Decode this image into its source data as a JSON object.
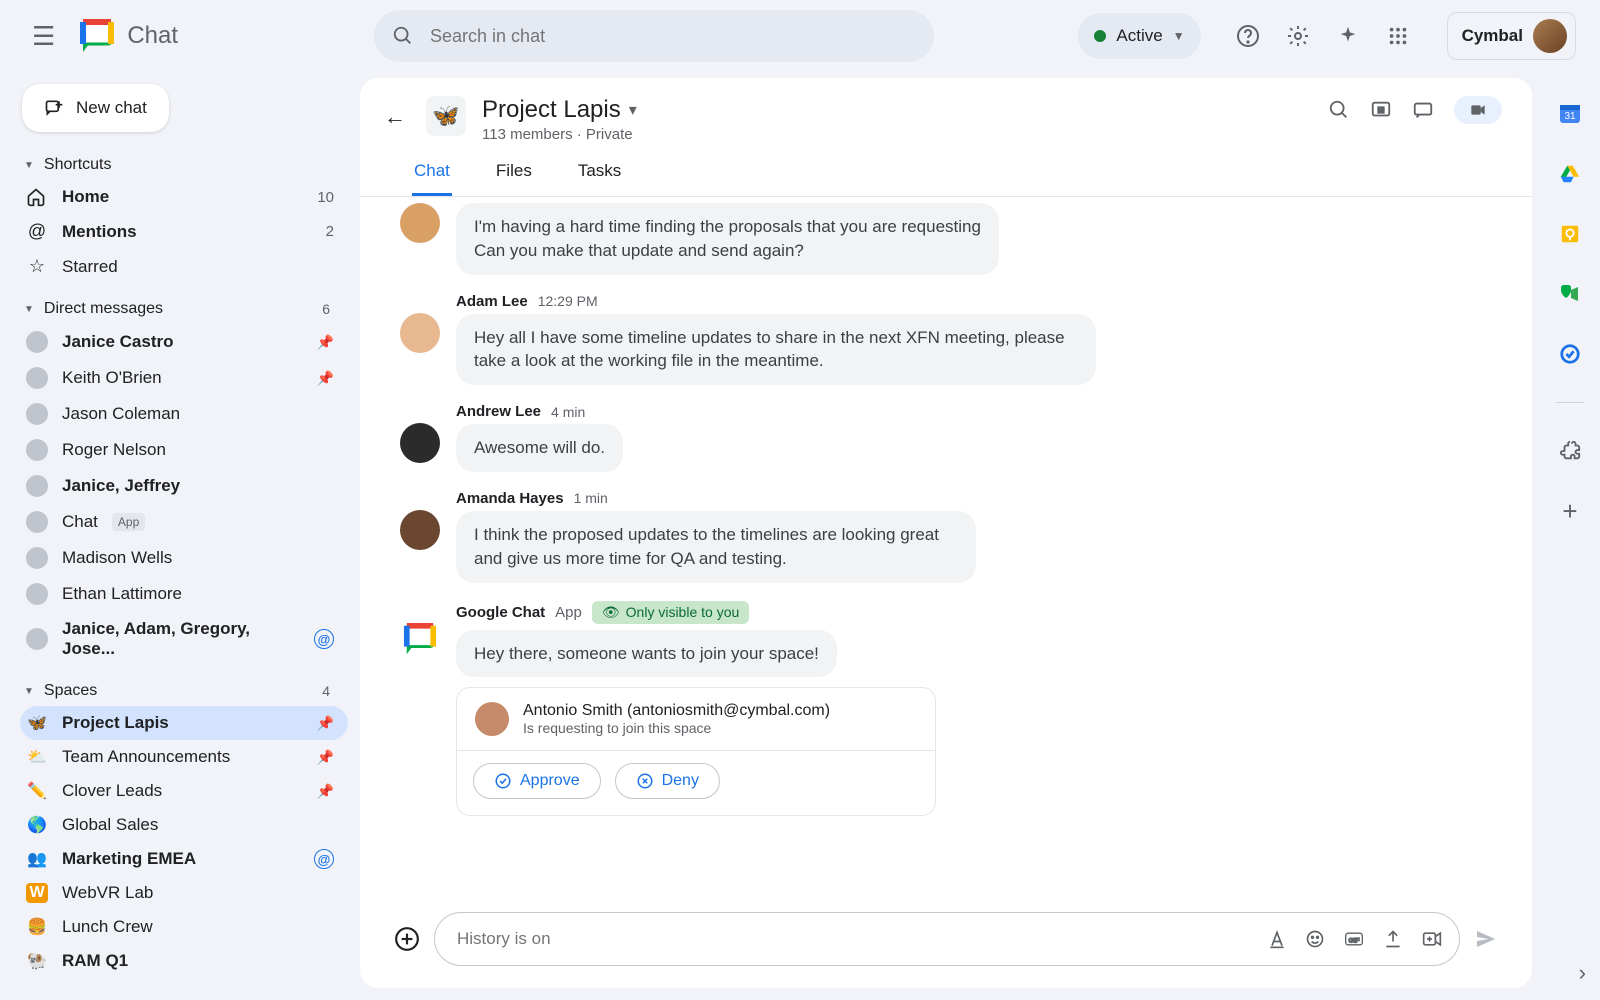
{
  "app_title": "Chat",
  "search_placeholder": "Search in chat",
  "status_label": "Active",
  "org_label": "Cymbal",
  "sidebar": {
    "new_chat": "New chat",
    "shortcuts_label": "Shortcuts",
    "home": "Home",
    "home_count": "10",
    "mentions": "Mentions",
    "mentions_count": "2",
    "starred": "Starred",
    "dms_label": "Direct messages",
    "dms_count": "6",
    "dms": [
      {
        "name": "Janice Castro",
        "bold": true,
        "pin": true
      },
      {
        "name": "Keith O'Brien",
        "bold": false,
        "pin": true
      },
      {
        "name": "Jason Coleman",
        "bold": false
      },
      {
        "name": "Roger Nelson",
        "bold": false
      },
      {
        "name": "Janice, Jeffrey",
        "bold": true
      },
      {
        "name": "Chat",
        "bold": false,
        "app": true
      },
      {
        "name": "Madison Wells",
        "bold": false
      },
      {
        "name": "Ethan Lattimore",
        "bold": false
      },
      {
        "name": "Janice, Adam, Gregory, Jose...",
        "bold": true,
        "mention": true
      }
    ],
    "app_badge": "App",
    "spaces_label": "Spaces",
    "spaces_count": "4",
    "spaces": [
      {
        "emoji": "🦋",
        "name": "Project Lapis",
        "bold": true,
        "pin": true,
        "selected": true
      },
      {
        "emoji": "⛅",
        "name": "Team Announcements",
        "pin": true
      },
      {
        "emoji": "✏️",
        "name": "Clover Leads",
        "pin": true
      },
      {
        "emoji": "🌎",
        "name": "Global Sales"
      },
      {
        "emoji": "👥",
        "name": "Marketing EMEA",
        "bold": true,
        "mention": true
      },
      {
        "emoji": "🟧",
        "name": "WebVR Lab",
        "wchar": "W"
      },
      {
        "emoji": "🍔",
        "name": "Lunch Crew"
      },
      {
        "emoji": "🐏",
        "name": "RAM Q1",
        "bold": true
      }
    ]
  },
  "header": {
    "emoji": "🦋",
    "title": "Project Lapis",
    "sub": "113 members · Private",
    "tabs": [
      "Chat",
      "Files",
      "Tasks"
    ],
    "active_tab": "Chat"
  },
  "messages": {
    "m0_line1": "I'm having a hard time finding the proposals that you are requesting",
    "m0_line2": "Can you make that update and send again?",
    "m1_name": "Adam Lee",
    "m1_time": "12:29 PM",
    "m1_text": "Hey all I have some timeline updates to share in the next XFN meeting, please take a look at the working file in the meantime.",
    "m2_name": "Andrew Lee",
    "m2_time": "4 min",
    "m2_text": "Awesome will do.",
    "m3_name": "Amanda Hayes",
    "m3_time": "1 min",
    "m3_text": "I think the proposed updates to the timelines are looking great and give us more time for QA and testing.",
    "sys_name": "Google Chat",
    "sys_app": "App",
    "sys_vis": "Only visible to you",
    "sys_text": "Hey there, someone wants to join your space!",
    "req_name": "Antonio Smith (antoniosmith@cymbal.com)",
    "req_sub": "Is requesting to join this space",
    "approve": "Approve",
    "deny": "Deny"
  },
  "composer_placeholder": "History is on"
}
